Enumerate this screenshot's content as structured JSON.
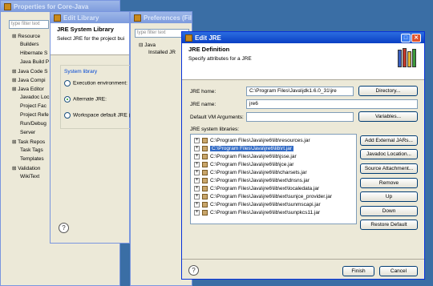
{
  "properties_window": {
    "title": "Properties for Core-Java",
    "filter_placeholder": "type filter text",
    "tree_items": [
      "Resource",
      "Builders",
      "Hibernate S",
      "Java Build P",
      "Java Code S",
      "Java Compi",
      "Java Editor",
      "Javadoc Loc",
      "Project Fac",
      "Project Refe",
      "Run/Debug",
      "Server",
      "Task Repos",
      "Task Tags",
      "Templates",
      "Validation",
      "WikiText"
    ]
  },
  "edit_library_window": {
    "title": "Edit Library",
    "header_title": "JRE System Library",
    "header_sub": "Select JRE for the project bui",
    "group_label": "System library",
    "options": [
      "Execution environment:",
      "Alternate JRE:",
      "Workspace default JRE (Ja"
    ]
  },
  "preferences_window": {
    "title": "Preferences (Filtered)",
    "filter_placeholder": "type filter text",
    "tree_root": "Java",
    "tree_child": "Installed JR"
  },
  "edit_jre": {
    "title": "Edit JRE",
    "header_title": "JRE Definition",
    "header_sub": "Specify attributes for a JRE",
    "jre_home_label": "JRE home:",
    "jre_home_value": "C:\\Program Files\\Java\\jdk1.6.0_31\\jre",
    "directory_button": "Directory...",
    "jre_name_label": "JRE name:",
    "jre_name_value": "jre6",
    "vm_args_label": "Default VM Arguments:",
    "variables_button": "Variables...",
    "libraries_label": "JRE system libraries:",
    "libraries": [
      "C:\\Program Files\\Java\\jre6\\lib\\resources.jar",
      "C:\\Program Files\\Java\\jre6\\lib\\rt.jar",
      "C:\\Program Files\\Java\\jre6\\lib\\jsse.jar",
      "C:\\Program Files\\Java\\jre6\\lib\\jce.jar",
      "C:\\Program Files\\Java\\jre6\\lib\\charsets.jar",
      "C:\\Program Files\\Java\\jre6\\lib\\ext\\dnsns.jar",
      "C:\\Program Files\\Java\\jre6\\lib\\ext\\localedata.jar",
      "C:\\Program Files\\Java\\jre6\\lib\\ext\\sunjce_provider.jar",
      "C:\\Program Files\\Java\\jre6\\lib\\ext\\sunmscapi.jar",
      "C:\\Program Files\\Java\\jre6\\lib\\ext\\sunpkcs11.jar"
    ],
    "side_buttons": [
      "Add External JARs...",
      "Javadoc Location...",
      "Source Attachment...",
      "Remove",
      "Up",
      "Down",
      "Restore Default"
    ],
    "finish_button": "Finish",
    "cancel_button": "Cancel"
  }
}
